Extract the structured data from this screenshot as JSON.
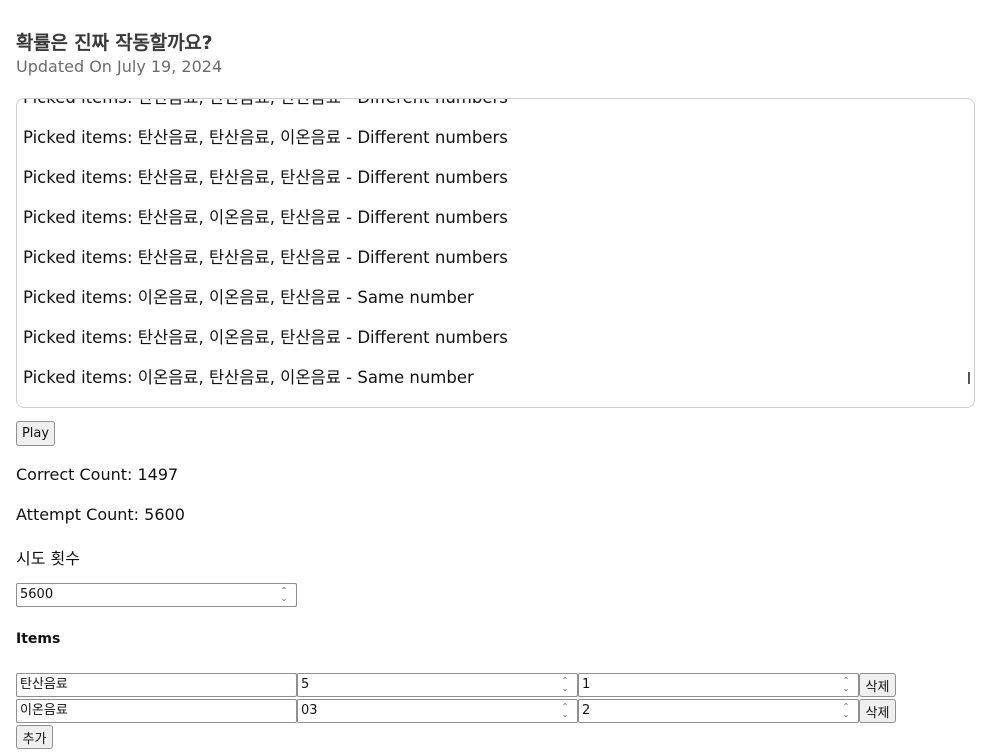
{
  "header": {
    "title": "확률은 진짜 작동할까요?",
    "updated": "Updated On July 19, 2024"
  },
  "log": {
    "lines": [
      "Picked items: 탄산음료, 탄산음료, 탄산음료 - Different numbers",
      "Picked items: 탄산음료, 탄산음료, 이온음료 - Different numbers",
      "Picked items: 탄산음료, 탄산음료, 탄산음료 - Different numbers",
      "Picked items: 탄산음료, 이온음료, 탄산음료 - Different numbers",
      "Picked items: 탄산음료, 탄산음료, 탄산음료 - Different numbers",
      "Picked items: 이온음료, 이온음료, 탄산음료 - Same number",
      "Picked items: 탄산음료, 이온음료, 탄산음료 - Different numbers",
      "Picked items: 이온음료, 탄산음료, 이온음료 - Same number"
    ]
  },
  "controls": {
    "play_label": "Play",
    "correct_count": "Correct Count: 1497",
    "attempt_count": "Attempt Count: 5600",
    "attempts_label": "시도 횟수",
    "attempts_value": "5600"
  },
  "items": {
    "heading": "Items",
    "rows": [
      {
        "name": "탄산음료",
        "a": "5",
        "b": "1",
        "delete_label": "삭제"
      },
      {
        "name": "이온음료",
        "a": "03",
        "b": "2",
        "delete_label": "삭제"
      }
    ],
    "add_label": "추가"
  }
}
